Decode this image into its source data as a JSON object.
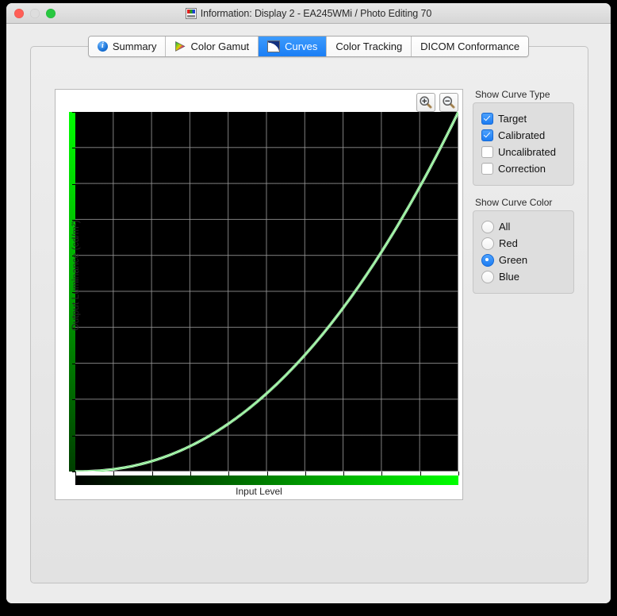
{
  "window": {
    "title": "Information: Display 2 - EA245WMi / Photo Editing 70",
    "title_icon": "display-document-icon",
    "close_label": "",
    "minimize_label": "",
    "maximize_label": ""
  },
  "tabs": [
    {
      "label": "Summary",
      "icon": "info-icon",
      "active": false
    },
    {
      "label": "Color Gamut",
      "icon": "gamut-triangle-icon",
      "active": false
    },
    {
      "label": "Curves",
      "icon": "curves-icon",
      "active": true
    },
    {
      "label": "Color Tracking",
      "icon": "",
      "active": false
    },
    {
      "label": "DICOM Conformance",
      "icon": "",
      "active": false
    }
  ],
  "graph": {
    "zoom_in_label": "zoom-in",
    "zoom_out_label": "zoom-out",
    "ylabel": "Output Luminance (cd/m²)",
    "xlabel": "Input Level"
  },
  "curve_type": {
    "title": "Show Curve Type",
    "options": [
      {
        "label": "Target",
        "checked": true
      },
      {
        "label": "Calibrated",
        "checked": true
      },
      {
        "label": "Uncalibrated",
        "checked": false
      },
      {
        "label": "Correction",
        "checked": false
      }
    ]
  },
  "curve_color": {
    "title": "Show Curve Color",
    "options": [
      {
        "label": "All",
        "selected": false
      },
      {
        "label": "Red",
        "selected": false
      },
      {
        "label": "Green",
        "selected": true
      },
      {
        "label": "Blue",
        "selected": false
      }
    ]
  },
  "colors": {
    "accent": "#1c7cf2",
    "curve_calibrated": "#55e060",
    "curve_target": "#ffffff",
    "plot_background": "#000000",
    "grid": "#969696",
    "channel_green": "#00ff00",
    "window_background": "#ececec"
  },
  "chart_data": {
    "type": "line",
    "title": "",
    "xlabel": "Input Level",
    "ylabel": "Output Luminance (cd/m²)",
    "xlim": [
      0,
      1
    ],
    "ylim": [
      0,
      1
    ],
    "grid": true,
    "grid_columns": 10,
    "grid_rows": 10,
    "legend": "none",
    "x_axis_colorbar": "black-to-green gradient",
    "y_axis_colorbar": "dark-green-to-bright-green gradient (bottom to top)",
    "x": [
      0,
      0.05,
      0.1,
      0.15,
      0.2,
      0.25,
      0.3,
      0.35,
      0.4,
      0.45,
      0.5,
      0.55,
      0.6,
      0.65,
      0.7,
      0.75,
      0.8,
      0.85,
      0.9,
      0.95,
      1.0
    ],
    "series": [
      {
        "name": "Target",
        "color": "#ffffff",
        "values": [
          0,
          0.0013,
          0.0059,
          0.0145,
          0.0276,
          0.0455,
          0.0685,
          0.0969,
          0.1307,
          0.1703,
          0.2176,
          0.2679,
          0.3255,
          0.3896,
          0.4603,
          0.5378,
          0.6222,
          0.7135,
          0.8118,
          0.9173,
          1.0
        ]
      },
      {
        "name": "Calibrated",
        "color": "#55e060",
        "values": [
          0,
          0.0013,
          0.0059,
          0.0145,
          0.0276,
          0.0455,
          0.0685,
          0.0969,
          0.1307,
          0.1703,
          0.2176,
          0.2679,
          0.3255,
          0.3896,
          0.4603,
          0.5378,
          0.6222,
          0.7135,
          0.8118,
          0.9173,
          1.0
        ]
      }
    ],
    "gamma": 2.2
  }
}
